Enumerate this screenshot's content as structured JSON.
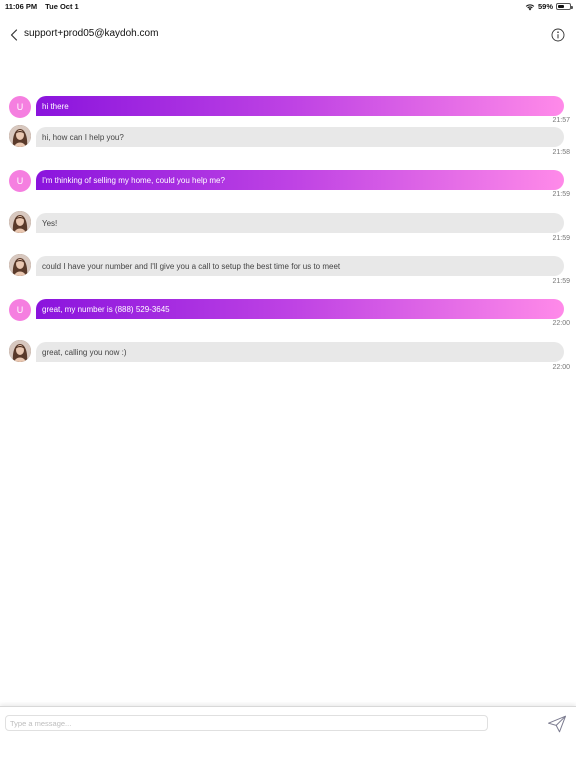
{
  "status_bar": {
    "time": "11:06 PM",
    "date": "Tue Oct 1",
    "battery": "59%",
    "battery_level": 0.59
  },
  "header": {
    "title": "support+prod05@kaydoh.com",
    "back_icon": "chevron-left-icon",
    "info_icon": "info-icon"
  },
  "messages": [
    {
      "sender": "user",
      "avatar": "U",
      "text": "hi there",
      "time": "21:57"
    },
    {
      "sender": "agent",
      "avatar": "",
      "text": "hi, how can I help you?",
      "time": "21:58"
    },
    {
      "sender": "user",
      "avatar": "U",
      "text": "I'm thinking of selling my home, could you help me?",
      "time": "21:59"
    },
    {
      "sender": "agent",
      "avatar": "",
      "text": "Yes!",
      "time": "21:59"
    },
    {
      "sender": "agent",
      "avatar": "",
      "text": "could I have your number and I'll give you a call to setup the best time for us to meet",
      "time": "21:59"
    },
    {
      "sender": "user",
      "avatar": "U",
      "text": "great, my number is (888) 529-3645",
      "time": "22:00"
    },
    {
      "sender": "agent",
      "avatar": "",
      "text": "great, calling you now :)",
      "time": "22:00"
    }
  ],
  "composer": {
    "placeholder": "Type a message...",
    "value": "",
    "send_icon": "send-icon"
  },
  "colors": {
    "user_gradient_start": "#8a14dd",
    "user_gradient_end": "#ff8ae9",
    "user_avatar": "#f57fe0",
    "agent_bubble": "#e8e8e8"
  }
}
